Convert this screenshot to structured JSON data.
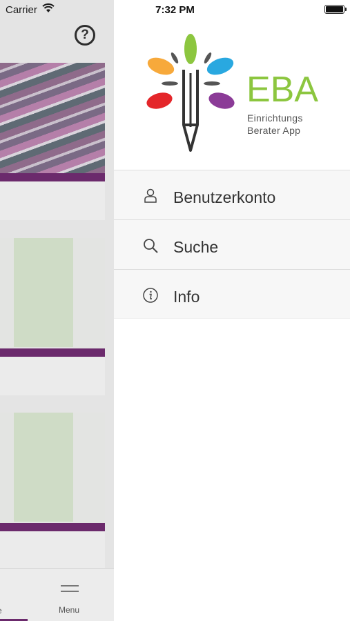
{
  "status_bar": {
    "carrier": "Carrier",
    "time": "7:32 PM"
  },
  "background": {
    "tabbar": {
      "left_label_partial": "e",
      "menu_label": "Menu"
    },
    "icons": [
      "help-icon",
      "menu-icon"
    ],
    "accent": "#6b2a6c"
  },
  "drawer": {
    "logo": {
      "title": "EBA",
      "subtitle_line1": "Einrichtungs",
      "subtitle_line2": "Berater App",
      "title_color": "#8cc63f"
    },
    "items": [
      {
        "label": "Benutzerkonto",
        "icon": "user-icon"
      },
      {
        "label": "Suche",
        "icon": "search-icon"
      },
      {
        "label": "Info",
        "icon": "info-icon"
      }
    ]
  }
}
